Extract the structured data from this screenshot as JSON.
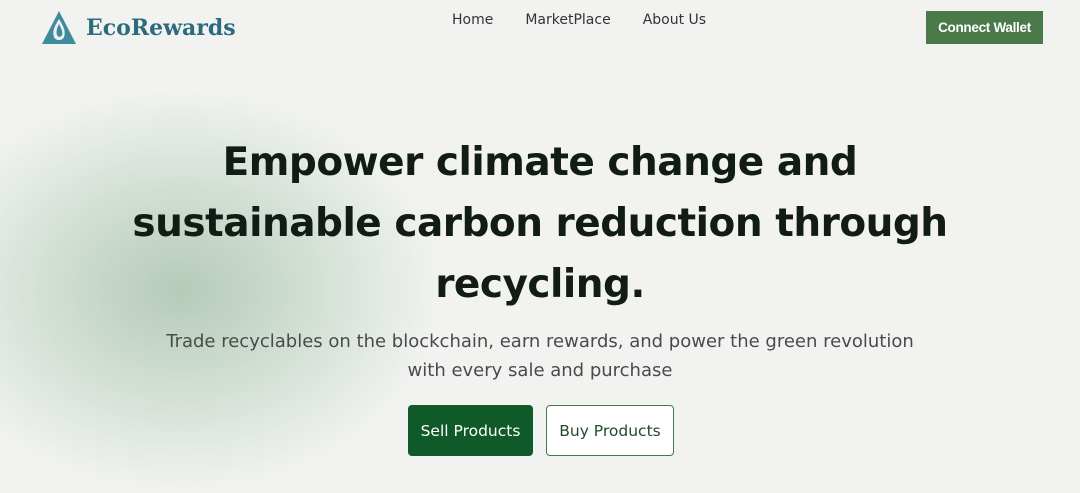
{
  "brand": {
    "name": "EcoRewards",
    "logo_icon": "water-drop-icon",
    "color": "#2b6b7d"
  },
  "nav": {
    "items": [
      "Home",
      "MarketPlace",
      "About Us"
    ]
  },
  "header": {
    "connect_wallet_label": "Connect Wallet"
  },
  "hero": {
    "title_lines": [
      "Empower climate change and",
      "sustainable carbon reduction through",
      "recycling."
    ],
    "subtitle_lines": [
      "Trade recyclables on the blockchain, earn rewards, and power the green revolution",
      "with every sale and purchase"
    ],
    "sell_label": "Sell Products",
    "buy_label": "Buy Products"
  },
  "colors": {
    "primary_green": "#0f5a28",
    "connect_green": "#4a7a4a",
    "background": "#f2f3f1"
  }
}
